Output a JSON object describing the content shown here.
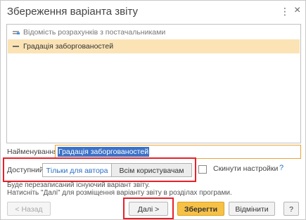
{
  "window": {
    "title": "Збереження варіанта звіту",
    "menu_icon": "⋮",
    "close_icon": "×"
  },
  "variants": [
    {
      "label": "Відомість розрахунків з постачальниками",
      "selected": false
    },
    {
      "label": "Градація заборгованостей",
      "selected": true
    }
  ],
  "name_field": {
    "label": "Найменування:",
    "value": "Градація заборгованостей"
  },
  "access": {
    "label": "Доступний:",
    "author_only": "Тільки для автора",
    "all_users": "Всім користувачам",
    "selected": "author_only"
  },
  "reset_settings": {
    "label": "Скинути настройки",
    "checked": false,
    "help": "?"
  },
  "info": {
    "line1": "Буде перезаписаний існуючий варіант звіту.",
    "line2": "Натисніть \"Далі\" для розміщення варіанту звіту в розділах програми."
  },
  "buttons": {
    "back": "< Назад",
    "next": "Далі >",
    "save": "Зберегти",
    "cancel": "Відмінити",
    "help": "?"
  },
  "colors": {
    "selected_row": "#fbe3b6",
    "primary_button": "#f6c146",
    "highlight_frame": "#e8202a",
    "link": "#2a6fc2"
  }
}
